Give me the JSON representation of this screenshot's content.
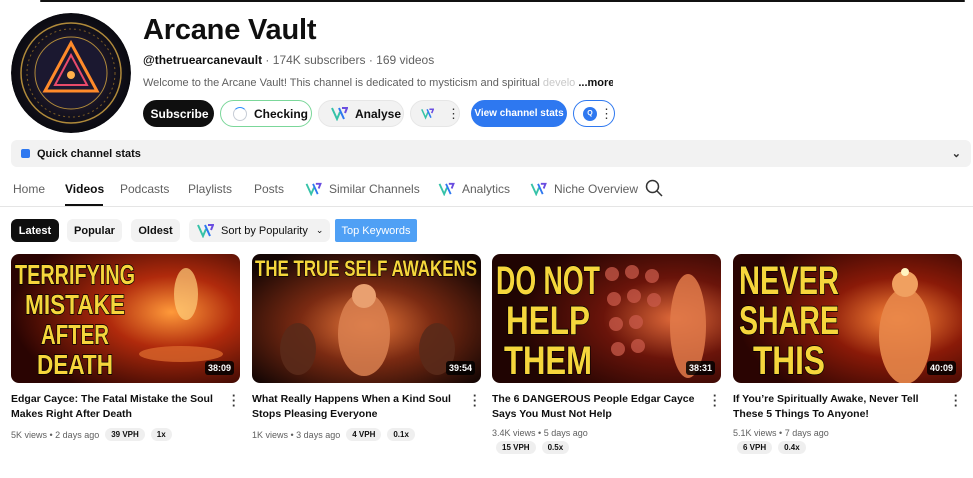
{
  "channel": {
    "name": "Arcane Vault",
    "handle": "@thetruearcanevault",
    "subscribers": "174K subscribers",
    "videos_count": "169 videos",
    "description_visible": "Welcome to the Arcane Vault! This channel is dedicated to mysticism and spiritual ",
    "description_faded": "develo",
    "more_label": "...more"
  },
  "buttons": {
    "subscribe": "Subscribe",
    "checking": "Checking",
    "analyse": "Analyse",
    "view_stats": "View channel stats",
    "ext_badge": "Q"
  },
  "quick_stats": {
    "label": "Quick channel stats"
  },
  "tabs": [
    "Home",
    "Videos",
    "Podcasts",
    "Playlists",
    "Posts",
    "Similar Channels",
    "Analytics",
    "Niche Overview"
  ],
  "chips": {
    "latest": "Latest",
    "popular": "Popular",
    "oldest": "Oldest",
    "sort": "Sort by Popularity",
    "top_keywords": "Top Keywords"
  },
  "videos": [
    {
      "thumb_lines": [
        "TERRIFYING",
        "MISTAKE",
        "AFTER",
        "DEATH"
      ],
      "duration": "38:09",
      "title": "Edgar Cayce: The Fatal Mistake the Soul Makes Right After Death",
      "views": "5K views",
      "age": "2 days ago",
      "vph": "39 VPH",
      "ratio": "1x"
    },
    {
      "thumb_lines": [
        "THE TRUE SELF AWAKENS"
      ],
      "duration": "39:54",
      "title": "What Really Happens When a Kind Soul Stops Pleasing Everyone",
      "views": "1K views",
      "age": "3 days ago",
      "vph": "4 VPH",
      "ratio": "0.1x"
    },
    {
      "thumb_lines": [
        "DO NOT",
        "HELP",
        "THEM"
      ],
      "duration": "38:31",
      "title": "The 6 DANGEROUS People Edgar Cayce Says You Must Not Help",
      "views": "3.4K views",
      "age": "5 days ago",
      "vph": "15 VPH",
      "ratio": "0.5x"
    },
    {
      "thumb_lines": [
        "NEVER",
        "SHARE",
        "THIS"
      ],
      "duration": "40:09",
      "title": "If You’re Spiritually Awake, Never Tell These 5 Things To Anyone!",
      "views": "5.1K views",
      "age": "7 days ago",
      "vph": "6 VPH",
      "ratio": "0.4x"
    }
  ],
  "colors": {
    "accent_blue": "#2e78f0",
    "keyword_blue": "#4fa0f5",
    "checking_border": "#7bd79a",
    "thumb_text_yellow": "#f6d63c",
    "thumb_bg_red": "#7a1608"
  },
  "icons": [
    "spinner-icon",
    "vidiq-logo-icon",
    "kebab-icon",
    "quick-stats-icon",
    "chevron-down-icon",
    "search-icon"
  ]
}
